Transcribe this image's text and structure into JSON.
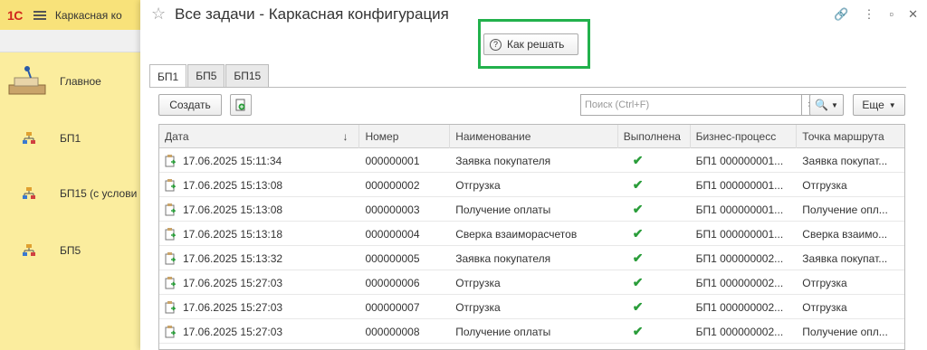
{
  "app": {
    "logo": "1С",
    "title": "Каркасная ко"
  },
  "sidebar": {
    "items": [
      {
        "label": "Главное"
      },
      {
        "label": "БП1"
      },
      {
        "label": "БП15 (с услови"
      },
      {
        "label": "БП5"
      }
    ]
  },
  "window": {
    "title": "Все задачи - Каркасная конфигурация",
    "help_button": "Как решать",
    "accent": "#22b14c"
  },
  "tabs": [
    {
      "label": "БП1"
    },
    {
      "label": "БП5"
    },
    {
      "label": "БП15"
    }
  ],
  "toolbar": {
    "create_label": "Создать",
    "search_placeholder": "Поиск (Ctrl+F)",
    "clear_label": "×",
    "more_label": "Еще"
  },
  "table": {
    "columns": [
      "Дата",
      "Номер",
      "Наименование",
      "Выполнена",
      "Бизнес-процесс",
      "Точка маршрута"
    ],
    "sort_marker": "↓",
    "rows": [
      {
        "date": "17.06.2025 15:11:34",
        "number": "000000001",
        "name": "Заявка покупателя",
        "done": "✔",
        "process": "БП1 000000001...",
        "point": "Заявка покупат..."
      },
      {
        "date": "17.06.2025 15:13:08",
        "number": "000000002",
        "name": "Отгрузка",
        "done": "✔",
        "process": "БП1 000000001...",
        "point": "Отгрузка"
      },
      {
        "date": "17.06.2025 15:13:08",
        "number": "000000003",
        "name": "Получение оплаты",
        "done": "✔",
        "process": "БП1 000000001...",
        "point": "Получение опл..."
      },
      {
        "date": "17.06.2025 15:13:18",
        "number": "000000004",
        "name": "Сверка взаиморасчетов",
        "done": "✔",
        "process": "БП1 000000001...",
        "point": "Сверка взаимо..."
      },
      {
        "date": "17.06.2025 15:13:32",
        "number": "000000005",
        "name": "Заявка покупателя",
        "done": "✔",
        "process": "БП1 000000002...",
        "point": "Заявка покупат..."
      },
      {
        "date": "17.06.2025 15:27:03",
        "number": "000000006",
        "name": "Отгрузка",
        "done": "✔",
        "process": "БП1 000000002...",
        "point": "Отгрузка"
      },
      {
        "date": "17.06.2025 15:27:03",
        "number": "000000007",
        "name": "Отгрузка",
        "done": "✔",
        "process": "БП1 000000002...",
        "point": "Отгрузка"
      },
      {
        "date": "17.06.2025 15:27:03",
        "number": "000000008",
        "name": "Получение оплаты",
        "done": "✔",
        "process": "БП1 000000002...",
        "point": "Получение опл..."
      }
    ]
  }
}
